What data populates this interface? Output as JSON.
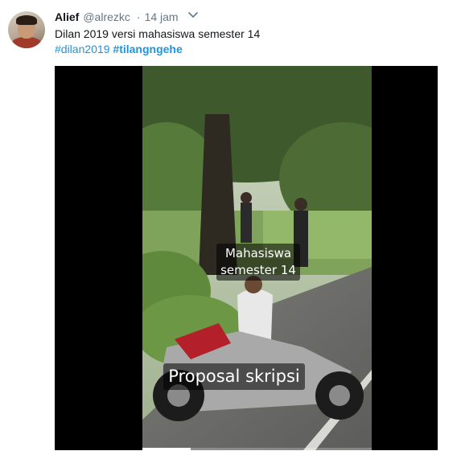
{
  "tweet": {
    "author_name": "Alief",
    "author_handle": "@alrezkc",
    "separator": "·",
    "timestamp": "14 jam",
    "menu_icon": "chevron-down-icon",
    "text": "Dilan 2019 versi mahasiswa semester 14",
    "hashtags": [
      "#dilan2019",
      "#tilangngehe"
    ]
  },
  "video": {
    "caption_top_line1": "Mahasiswa",
    "caption_top_line2": "semester 14",
    "caption_bottom": "Proposal skripsi",
    "progress_fraction": 0.21
  },
  "colors": {
    "link": "#1b95e0",
    "secondary_text": "#657786",
    "primary_text": "#14171a"
  }
}
